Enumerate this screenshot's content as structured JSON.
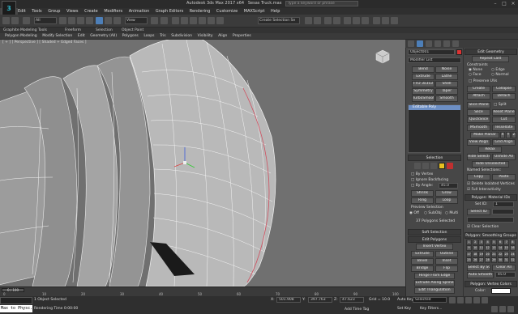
{
  "app": {
    "title": "Autodesk 3ds Max 2017 x64",
    "file": "Sesas Truck.max",
    "search_placeholder": "Type a keyword or phrase",
    "logo": "3"
  },
  "menu": [
    "Edit",
    "Tools",
    "Group",
    "Views",
    "Create",
    "Modifiers",
    "Animation",
    "Graph Editors",
    "Rendering",
    "Customize",
    "MAXScript",
    "Help"
  ],
  "toolbar": {
    "selection_filter": "All",
    "reference_coord": "View",
    "named_selection": "Create Selection Se"
  },
  "ribbon_tabs": [
    "Graphite Modeling Tools",
    "Freeform",
    "Selection",
    "Object Paint"
  ],
  "ribbon_items": [
    "Polygon Modeling",
    "Modify Selection",
    "Edit",
    "Geometry (All)",
    "Polygons",
    "Loops",
    "Tris",
    "Subdivision",
    "Visibility",
    "Align",
    "Properties"
  ],
  "viewport": {
    "label": "[ + ] [ Perspective ] [ Shaded + Edged Faces ]"
  },
  "modify_panel": {
    "object_name": "Object001",
    "modifier_list": "Modifier List",
    "modifier_buttons": [
      [
        "Bend",
        "Noise"
      ],
      [
        "Extrude",
        "Lathe"
      ],
      [
        "FFD 3x3x3",
        "Shell"
      ],
      [
        "Symmetry",
        "Taper"
      ],
      [
        "TurboSmooth",
        "Smooth"
      ]
    ],
    "stack_item": "Editable Poly"
  },
  "selection_rollout": {
    "title": "Selection",
    "by_vertex": "By Vertex",
    "ignore_backfacing": "Ignore Backfacing",
    "by_angle": "By Angle:",
    "angle_value": "45.0",
    "shrink": "Shrink",
    "grow": "Grow",
    "ring": "Ring",
    "loop": "Loop",
    "preview_selection": "Preview Selection",
    "preview_options": [
      "Off",
      "SubObj",
      "Multi"
    ],
    "selected_info": "37 Polygons Selected"
  },
  "soft_selection": "Soft Selection",
  "edit_polygons": {
    "title": "Edit Polygons",
    "insert_vertex": "Insert Vertex",
    "buttons": [
      [
        "Extrude",
        "Outline"
      ],
      [
        "Bevel",
        "Inset"
      ],
      [
        "Bridge",
        "Flip"
      ]
    ],
    "hinge": "Hinge From Edge",
    "extrude_spline": "Extrude Along Spline",
    "edit_triangulation": "Edit Triangulation",
    "retriangulate": "Retriangulate",
    "turn": "Turn"
  },
  "edit_geometry": {
    "title": "Edit Geometry",
    "repeat_last": "Repeat Last",
    "constraints": "Constraints",
    "constraint_options": [
      "None",
      "Edge",
      "Face",
      "Normal"
    ],
    "preserve_uvs": "Preserve UVs",
    "create": "Create",
    "collapse": "Collapse",
    "attach": "Attach",
    "detach": "Detach",
    "slice_plane": "Slice Plane",
    "split": "Split",
    "slice": "Slice",
    "reset_plane": "Reset Plane",
    "quickslice": "QuickSlice",
    "cut": "Cut",
    "msmooth": "MSmooth",
    "tessellate": "Tessellate",
    "make_planar": "Make Planar",
    "xyz": [
      "X",
      "Y",
      "Z"
    ],
    "view_align": "View Align",
    "grid_align": "Grid Align",
    "relax": "Relax",
    "hide_selected": "Hide Selected",
    "unhide_all": "Unhide All",
    "hide_unselected": "Hide Unselected",
    "named_selections": "Named Selections:",
    "copy": "Copy",
    "paste": "Paste",
    "delete_isolated": "Delete Isolated Vertices",
    "full_interactivity": "Full Interactivity"
  },
  "material_ids": {
    "title": "Polygon: Material IDs",
    "set_id": "Set ID:",
    "select_id": "Select ID",
    "set_id_value": "1",
    "clear_selection": "Clear Selection"
  },
  "smoothing": {
    "title": "Polygon: Smoothing Groups",
    "numbers": [
      "1",
      "2",
      "3",
      "4",
      "5",
      "6",
      "7",
      "8",
      "9",
      "10",
      "11",
      "12",
      "13",
      "14",
      "15",
      "16",
      "17",
      "18",
      "19",
      "20",
      "21",
      "22",
      "23",
      "24",
      "25",
      "26",
      "27",
      "28",
      "29",
      "30",
      "31",
      "32"
    ],
    "select_by_sg": "Select By SG",
    "clear_all": "Clear All",
    "auto_smooth": "Auto Smooth",
    "auto_smooth_value": "45.0"
  },
  "vertex_colors": {
    "title": "Polygon: Vertex Colors",
    "color": "Color:"
  },
  "timeline": {
    "frame": "0 / 100",
    "ticks": [
      "0",
      "10",
      "20",
      "30",
      "40",
      "50",
      "60",
      "70",
      "80",
      "90",
      "100"
    ]
  },
  "status": {
    "maxscript": "Max to Physc.",
    "objects_selected": "1 Object Selected",
    "rendering_time": "Rendering Time 0:00:00",
    "x_label": "X:",
    "x_value": "501.908",
    "y_label": "Y:",
    "y_value": "397.763",
    "z_label": "Z:",
    "z_value": "47.623",
    "grid": "Grid = 10.0",
    "add_time_tag": "Add Time Tag",
    "auto_key": "Auto Key",
    "selected": "Selected",
    "set_key": "Set Key",
    "key_filters": "Key Filters..."
  }
}
